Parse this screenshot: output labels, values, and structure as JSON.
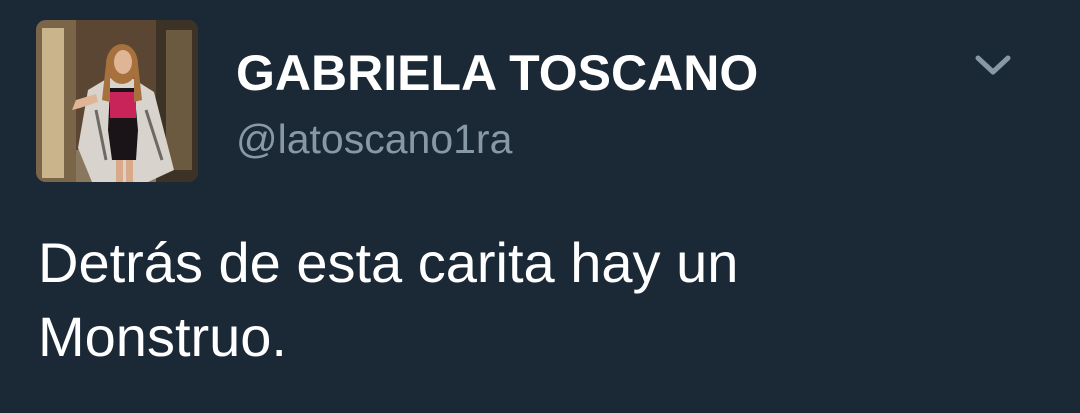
{
  "tweet": {
    "display_name": "GABRIELA TOSCANO",
    "handle": "@latoscano1ra",
    "text_lines": [
      "Detrás de esta carita hay un",
      "Monstruo."
    ],
    "menu_icon": "chevron-down-icon"
  },
  "colors": {
    "background": "#1b2836",
    "name": "#ffffff",
    "handle": "#8899a6",
    "chevron": "#8899a6",
    "text": "#ffffff"
  }
}
